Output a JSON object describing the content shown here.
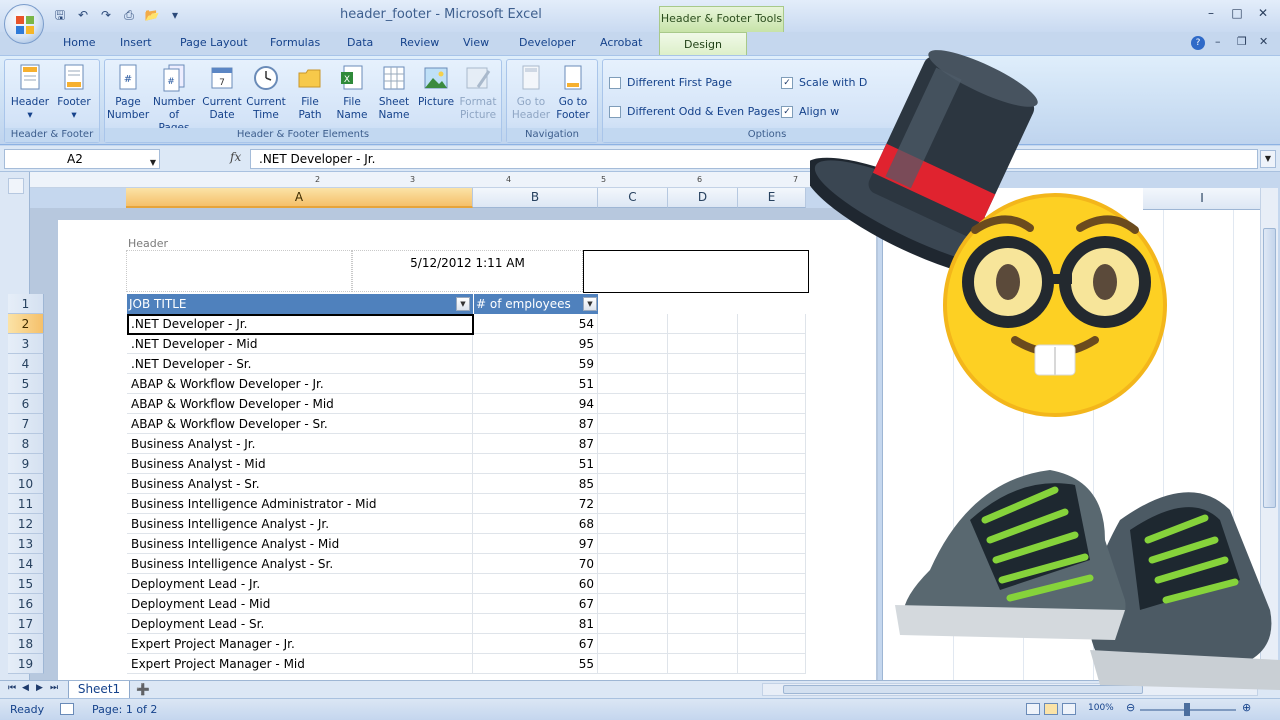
{
  "window": {
    "title": "header_footer - Microsoft Excel",
    "context_tools": "Header & Footer Tools"
  },
  "ribbon_tabs": [
    "Home",
    "Insert",
    "Page Layout",
    "Formulas",
    "Data",
    "Review",
    "View",
    "Developer",
    "Acrobat",
    "Design"
  ],
  "active_tab": "Design",
  "groups": {
    "header_footer": {
      "label": "Header & Footer",
      "header_btn": "Header",
      "footer_btn": "Footer"
    },
    "elements": {
      "label": "Header & Footer Elements",
      "page_number": [
        "Page",
        "Number"
      ],
      "number_of_pages": [
        "Number",
        "of Pages"
      ],
      "current_date": [
        "Current",
        "Date"
      ],
      "current_time": [
        "Current",
        "Time"
      ],
      "file_path": [
        "File",
        "Path"
      ],
      "file_name": [
        "File",
        "Name"
      ],
      "sheet_name": [
        "Sheet",
        "Name"
      ],
      "picture": "Picture",
      "format_picture": [
        "Format",
        "Picture"
      ]
    },
    "navigation": {
      "label": "Navigation",
      "go_to_header": [
        "Go to",
        "Header"
      ],
      "go_to_footer": [
        "Go to",
        "Footer"
      ]
    },
    "options": {
      "label": "Options",
      "different_first_page": "Different First Page",
      "different_odd_even": "Different Odd & Even Pages",
      "scale_with": "Scale with D",
      "align_with": "Align w"
    }
  },
  "formula_bar": {
    "name_box": "A2",
    "fx": "fx",
    "value": ".NET Developer - Jr."
  },
  "columns": [
    "A",
    "B",
    "C",
    "D",
    "E"
  ],
  "right_columns": [
    "I"
  ],
  "ruler_marks": [
    "1",
    "2",
    "3",
    "4",
    "5",
    "6",
    "7"
  ],
  "page_header": {
    "label": "Header",
    "center": "5/12/2012 1:11 AM"
  },
  "table": {
    "headers": [
      "JOB TITLE",
      "# of employees"
    ],
    "rows": [
      {
        "n": "2",
        "title": ".NET Developer - Jr.",
        "count": "54"
      },
      {
        "n": "3",
        "title": ".NET Developer - Mid",
        "count": "95"
      },
      {
        "n": "4",
        "title": ".NET Developer - Sr.",
        "count": "59"
      },
      {
        "n": "5",
        "title": "ABAP & Workflow Developer - Jr.",
        "count": "51"
      },
      {
        "n": "6",
        "title": "ABAP & Workflow Developer - Mid",
        "count": "94"
      },
      {
        "n": "7",
        "title": "ABAP & Workflow Developer - Sr.",
        "count": "87"
      },
      {
        "n": "8",
        "title": "Business Analyst - Jr.",
        "count": "87"
      },
      {
        "n": "9",
        "title": "Business Analyst - Mid",
        "count": "51"
      },
      {
        "n": "10",
        "title": "Business Analyst - Sr.",
        "count": "85"
      },
      {
        "n": "11",
        "title": "Business Intelligence Administrator - Mid",
        "count": "72"
      },
      {
        "n": "12",
        "title": "Business Intelligence Analyst - Jr.",
        "count": "68"
      },
      {
        "n": "13",
        "title": "Business Intelligence Analyst - Mid",
        "count": "97"
      },
      {
        "n": "14",
        "title": "Business Intelligence Analyst - Sr.",
        "count": "70"
      },
      {
        "n": "15",
        "title": "Deployment Lead - Jr.",
        "count": "60"
      },
      {
        "n": "16",
        "title": "Deployment Lead - Mid",
        "count": "67"
      },
      {
        "n": "17",
        "title": "Deployment Lead - Sr.",
        "count": "81"
      },
      {
        "n": "18",
        "title": "Expert Project Manager - Jr.",
        "count": "67"
      },
      {
        "n": "19",
        "title": "Expert Project Manager - Mid",
        "count": "55"
      }
    ]
  },
  "sheet_tab": "Sheet1",
  "status": {
    "ready": "Ready",
    "page": "Page: 1 of 2",
    "zoom": "100%"
  },
  "colors": {
    "table_header": "#4f81bd",
    "selection": "#f5c06a",
    "ribbon": "#dfeefb"
  }
}
